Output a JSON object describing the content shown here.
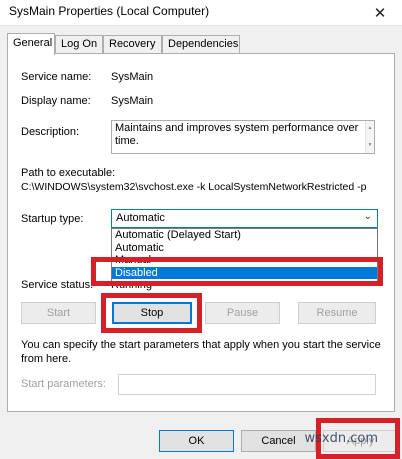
{
  "window": {
    "title": "SysMain Properties (Local Computer)",
    "close_glyph": "✕"
  },
  "tabs": [
    {
      "label": "General",
      "active": true
    },
    {
      "label": "Log On",
      "active": false
    },
    {
      "label": "Recovery",
      "active": false
    },
    {
      "label": "Dependencies",
      "active": false
    }
  ],
  "general": {
    "service_name_label": "Service name:",
    "service_name_value": "SysMain",
    "display_name_label": "Display name:",
    "display_name_value": "SysMain",
    "description_label": "Description:",
    "description_value": "Maintains and improves system performance over time.",
    "path_label": "Path to executable:",
    "path_value": "C:\\WINDOWS\\system32\\svchost.exe -k LocalSystemNetworkRestricted -p",
    "startup_type_label": "Startup type:",
    "startup_type_value": "Automatic",
    "startup_options": [
      {
        "label": "Automatic (Delayed Start)",
        "selected": false
      },
      {
        "label": "Automatic",
        "selected": false
      },
      {
        "label": "Manual",
        "selected": false
      },
      {
        "label": "Disabled",
        "selected": true
      }
    ],
    "service_status_label": "Service status:",
    "service_status_value": "Running",
    "buttons": {
      "start": "Start",
      "stop": "Stop",
      "pause": "Pause",
      "resume": "Resume"
    },
    "help_text": "You can specify the start parameters that apply when you start the service from here.",
    "start_parameters_label": "Start parameters:",
    "start_parameters_value": ""
  },
  "footer": {
    "ok": "OK",
    "cancel": "Cancel",
    "apply": "Apply"
  },
  "watermark": "wsxdn.com",
  "colors": {
    "highlight": "#d62027",
    "selection": "#0078d7"
  }
}
